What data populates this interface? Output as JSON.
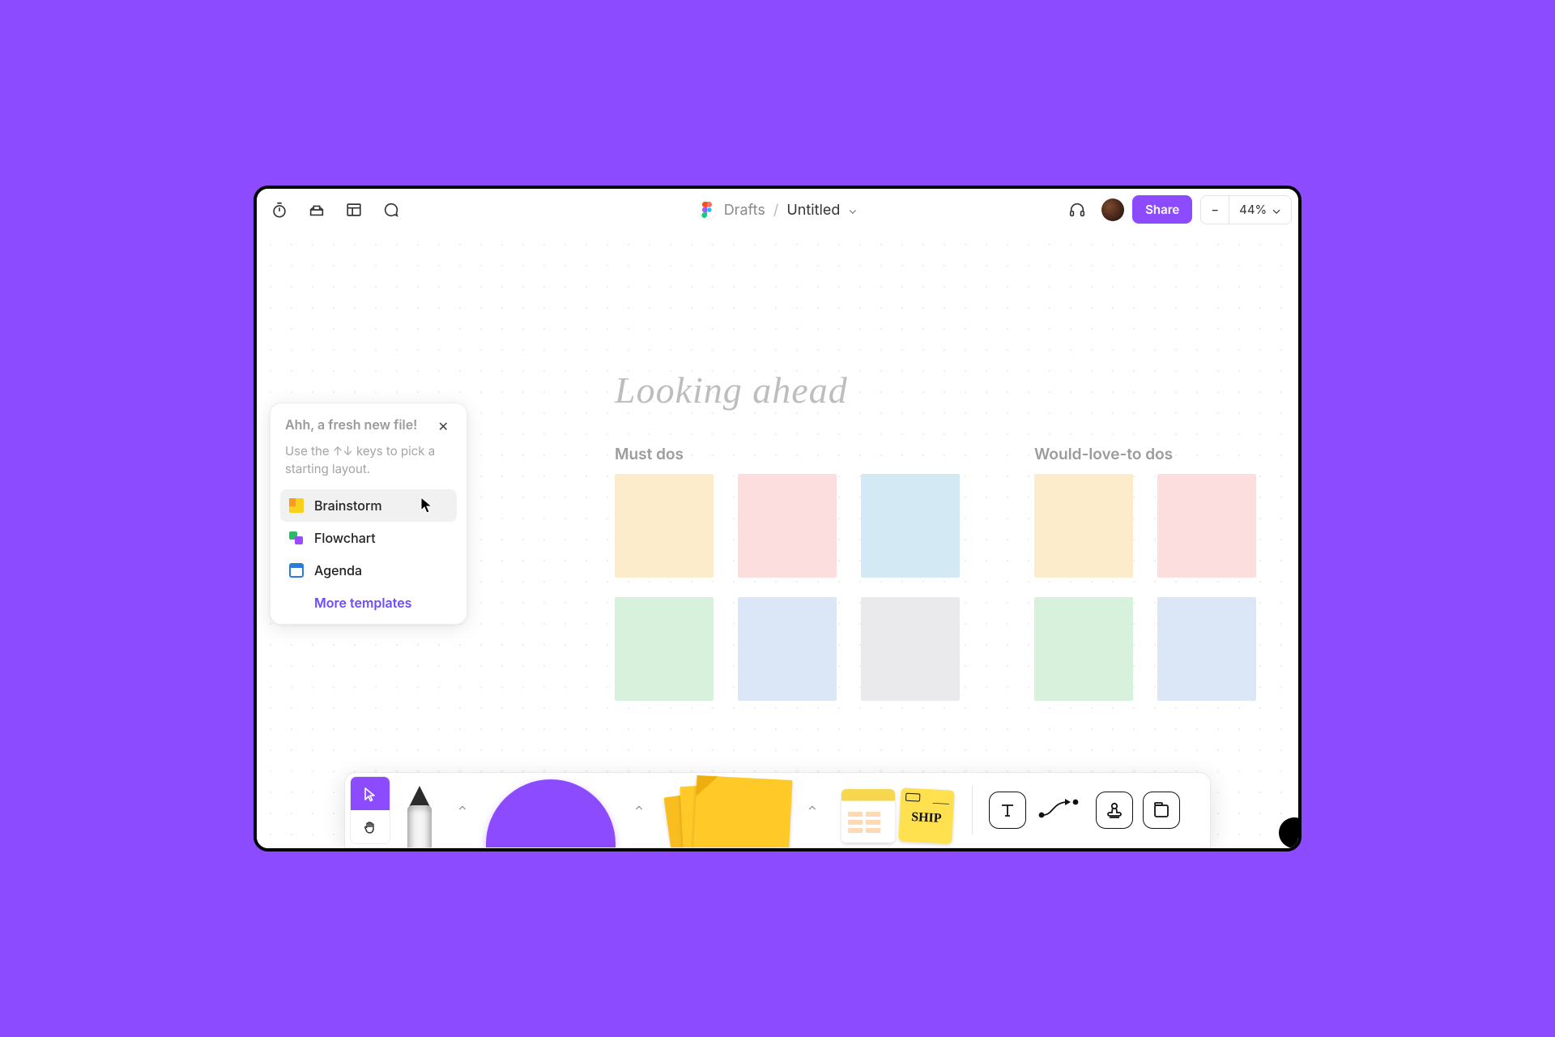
{
  "breadcrumb": {
    "drafts": "Drafts",
    "separator": "/",
    "title": "Untitled"
  },
  "topbar": {
    "share_label": "Share",
    "zoom": "44%"
  },
  "canvas": {
    "heading": "Looking ahead",
    "sections": {
      "must": "Must dos",
      "love": "Would-love-to dos"
    }
  },
  "panel": {
    "title": "Ahh, a fresh new file!",
    "subtitle": "Use the ↑↓ keys to pick a starting layout.",
    "items": [
      {
        "key": "brainstorm",
        "label": "Brainstorm"
      },
      {
        "key": "flowchart",
        "label": "Flowchart"
      },
      {
        "key": "agenda",
        "label": "Agenda"
      }
    ],
    "more": "More templates"
  },
  "dock": {
    "ship_label": "SHIP"
  }
}
